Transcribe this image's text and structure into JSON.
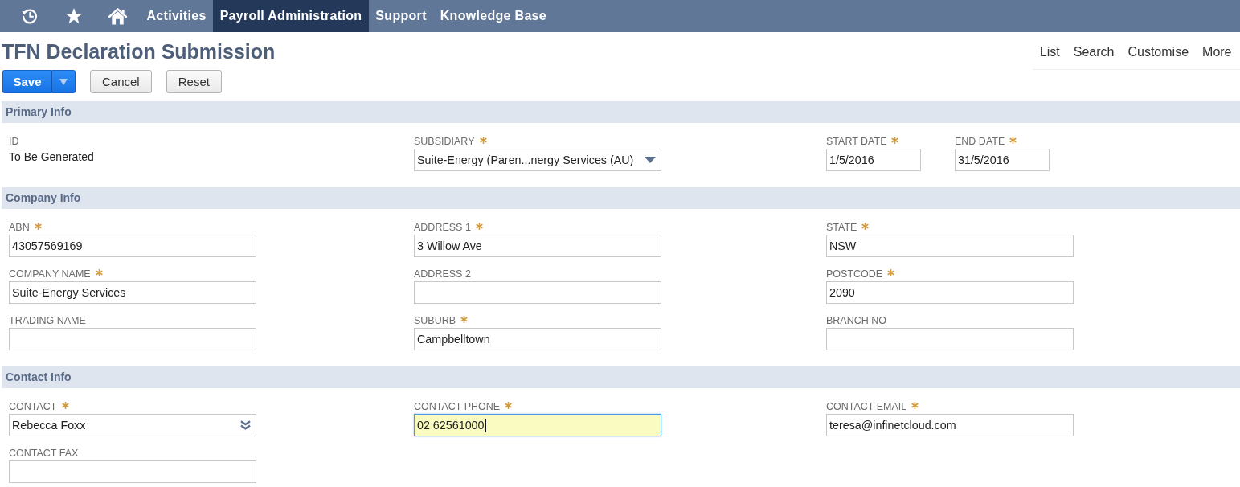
{
  "nav": {
    "items": [
      {
        "label": "Activities",
        "selected": false
      },
      {
        "label": "Payroll Administration",
        "selected": true
      },
      {
        "label": "Support",
        "selected": false
      },
      {
        "label": "Knowledge Base",
        "selected": false
      }
    ]
  },
  "page_title": "TFN Declaration Submission",
  "page_links": [
    "List",
    "Search",
    "Customise",
    "More"
  ],
  "buttons": [
    {
      "label": "Save",
      "kind": "split"
    },
    {
      "label": "Cancel",
      "kind": "default"
    },
    {
      "label": "Reset",
      "kind": "default"
    }
  ],
  "sections": [
    {
      "title": "Primary Info",
      "columns": [
        [
          {
            "label": "ID",
            "required": false,
            "kind": "static",
            "value": "To Be Generated"
          }
        ],
        [
          {
            "label": "SUBSIDIARY",
            "required": true,
            "kind": "select",
            "focused": false,
            "value": "Suite-Energy (Paren...nergy Services (AU)"
          }
        ],
        [
          {
            "label": "START DATE",
            "required": true,
            "kind": "date",
            "focused": false,
            "value": "1/5/2016"
          },
          {
            "label": "END DATE",
            "required": true,
            "kind": "date",
            "focused": false,
            "value": "31/5/2016"
          }
        ]
      ]
    },
    {
      "title": "Company Info",
      "columns": [
        [
          {
            "label": "ABN",
            "required": true,
            "kind": "text",
            "focused": false,
            "value": "43057569169"
          },
          {
            "label": "COMPANY NAME",
            "required": true,
            "kind": "text",
            "focused": false,
            "value": "Suite-Energy Services"
          },
          {
            "label": "TRADING NAME",
            "required": false,
            "kind": "text",
            "focused": false
          }
        ],
        [
          {
            "label": "ADDRESS 1",
            "required": true,
            "kind": "text",
            "focused": false,
            "value": "3 Willow Ave"
          },
          {
            "label": "ADDRESS 2",
            "required": false,
            "kind": "text",
            "focused": false
          },
          {
            "label": "SUBURB",
            "required": true,
            "kind": "text",
            "focused": false,
            "value": "Campbelltown"
          }
        ],
        [
          {
            "label": "STATE",
            "required": true,
            "kind": "text",
            "focused": false,
            "value": "NSW"
          },
          {
            "label": "POSTCODE",
            "required": true,
            "kind": "text",
            "focused": false,
            "value": "2090"
          },
          {
            "label": "BRANCH NO",
            "required": false,
            "kind": "text",
            "focused": false
          }
        ]
      ]
    },
    {
      "title": "Contact Info",
      "columns": [
        [
          {
            "label": "CONTACT",
            "required": true,
            "kind": "popup",
            "focused": false,
            "value": "Rebecca Foxx"
          },
          {
            "label": "CONTACT FAX",
            "required": false,
            "kind": "text",
            "focused": false
          }
        ],
        [
          {
            "label": "CONTACT PHONE",
            "required": true,
            "kind": "text",
            "focused": true,
            "value": "02 62561000"
          }
        ],
        [
          {
            "label": "CONTACT EMAIL",
            "required": true,
            "kind": "text",
            "focused": false,
            "value": "teresa@infinetcloud.com"
          }
        ]
      ]
    }
  ]
}
